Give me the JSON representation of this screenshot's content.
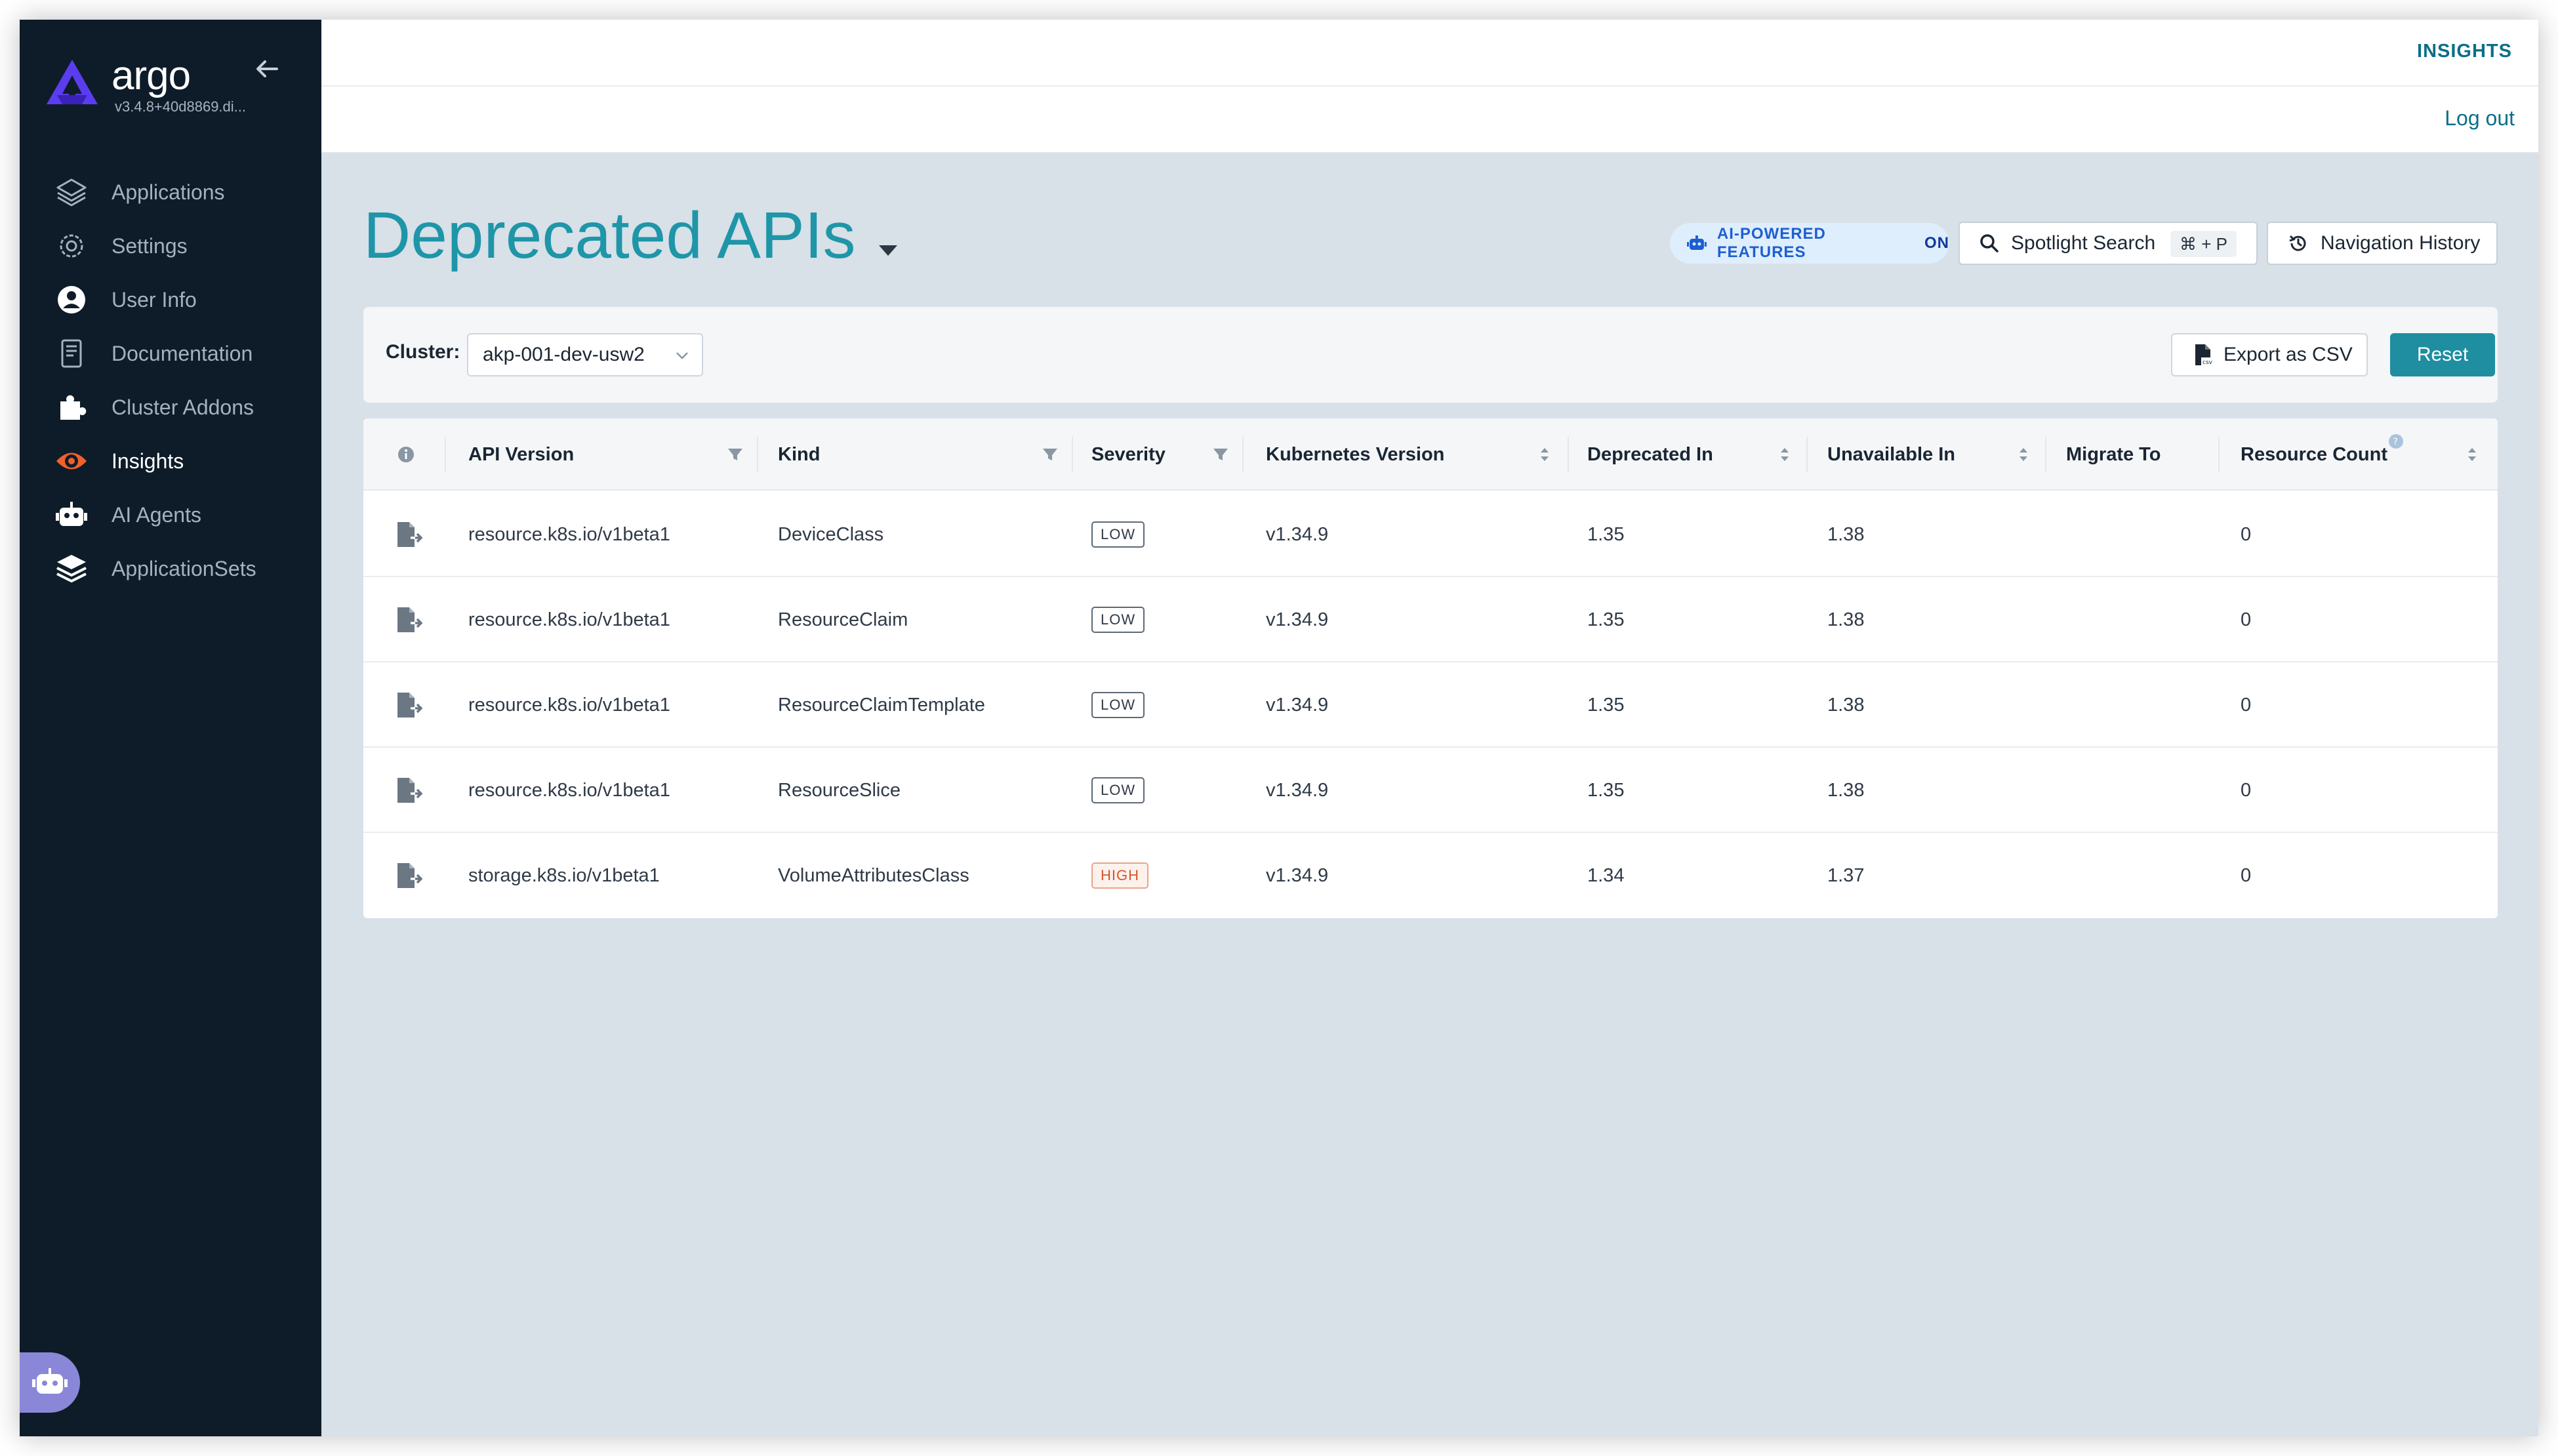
{
  "sidebar": {
    "brand": "argo",
    "version": "v3.4.8+40d8869.di...",
    "items": [
      {
        "label": "Applications",
        "icon": "layers-icon",
        "active": false
      },
      {
        "label": "Settings",
        "icon": "gear-icon",
        "active": false
      },
      {
        "label": "User Info",
        "icon": "user-icon",
        "active": false
      },
      {
        "label": "Documentation",
        "icon": "document-icon",
        "active": false
      },
      {
        "label": "Cluster Addons",
        "icon": "puzzle-icon",
        "active": false
      },
      {
        "label": "Insights",
        "icon": "eye-icon",
        "active": true
      },
      {
        "label": "AI Agents",
        "icon": "robot-icon",
        "active": false
      },
      {
        "label": "ApplicationSets",
        "icon": "stack-icon",
        "active": false
      }
    ]
  },
  "topbar": {
    "insights": "INSIGHTS",
    "logout": "Log out"
  },
  "header": {
    "title": "Deprecated APIs",
    "ai_badge": "AI-POWERED FEATURES",
    "ai_badge_state": "ON",
    "spotlight": "Spotlight Search",
    "spotlight_shortcut": "⌘ + P",
    "nav_history": "Navigation History"
  },
  "filters": {
    "cluster_label": "Cluster:",
    "cluster_value": "akp-001-dev-usw2",
    "export": "Export as CSV",
    "reset": "Reset"
  },
  "table": {
    "columns": {
      "api_version": "API Version",
      "kind": "Kind",
      "severity": "Severity",
      "k8s_version": "Kubernetes Version",
      "deprecated_in": "Deprecated In",
      "unavailable_in": "Unavailable In",
      "migrate_to": "Migrate To",
      "resource_count": "Resource Count"
    },
    "rows": [
      {
        "api_version": "resource.k8s.io/v1beta1",
        "kind": "DeviceClass",
        "severity": "LOW",
        "k8s_version": "v1.34.9",
        "deprecated_in": "1.35",
        "unavailable_in": "1.38",
        "migrate_to": "",
        "resource_count": "0"
      },
      {
        "api_version": "resource.k8s.io/v1beta1",
        "kind": "ResourceClaim",
        "severity": "LOW",
        "k8s_version": "v1.34.9",
        "deprecated_in": "1.35",
        "unavailable_in": "1.38",
        "migrate_to": "",
        "resource_count": "0"
      },
      {
        "api_version": "resource.k8s.io/v1beta1",
        "kind": "ResourceClaimTemplate",
        "severity": "LOW",
        "k8s_version": "v1.34.9",
        "deprecated_in": "1.35",
        "unavailable_in": "1.38",
        "migrate_to": "",
        "resource_count": "0"
      },
      {
        "api_version": "resource.k8s.io/v1beta1",
        "kind": "ResourceSlice",
        "severity": "LOW",
        "k8s_version": "v1.34.9",
        "deprecated_in": "1.35",
        "unavailable_in": "1.38",
        "migrate_to": "",
        "resource_count": "0"
      },
      {
        "api_version": "storage.k8s.io/v1beta1",
        "kind": "VolumeAttributesClass",
        "severity": "HIGH",
        "k8s_version": "v1.34.9",
        "deprecated_in": "1.34",
        "unavailable_in": "1.37",
        "migrate_to": "",
        "resource_count": "0"
      }
    ]
  },
  "colors": {
    "sidebar_bg": "#0e1c29",
    "accent": "#1e8ea0",
    "title": "#1e96a8",
    "active_icon": "#f0602a",
    "brand_logo": "#5b3df0"
  }
}
